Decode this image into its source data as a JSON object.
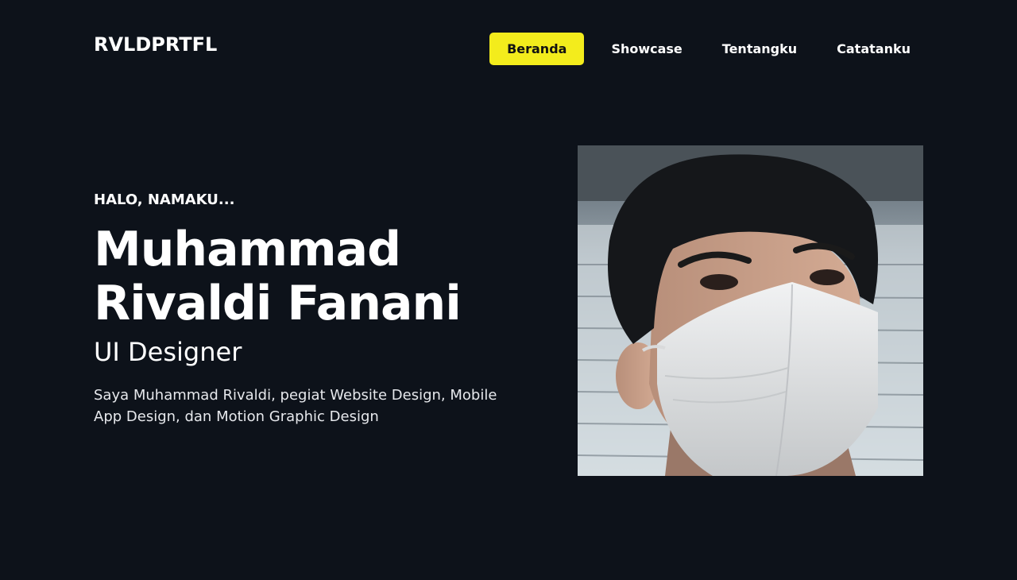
{
  "brand": {
    "logo": "RVLDPRTFL"
  },
  "nav": {
    "items": [
      {
        "label": "Beranda",
        "active": true
      },
      {
        "label": "Showcase",
        "active": false
      },
      {
        "label": "Tentangku",
        "active": false
      },
      {
        "label": "Catatanku",
        "active": false
      }
    ]
  },
  "hero": {
    "greeting": "HALO, NAMAKU...",
    "name_line1": "Muhammad",
    "name_line2": "Rivaldi Fanani",
    "role": "UI Designer",
    "description": "Saya Muhammad Rivaldi, pegiat Website Design, Mobile App Design, dan Motion Graphic Design"
  },
  "colors": {
    "background": "#0d121a",
    "accent": "#f3ec1c",
    "text": "#ffffff"
  }
}
